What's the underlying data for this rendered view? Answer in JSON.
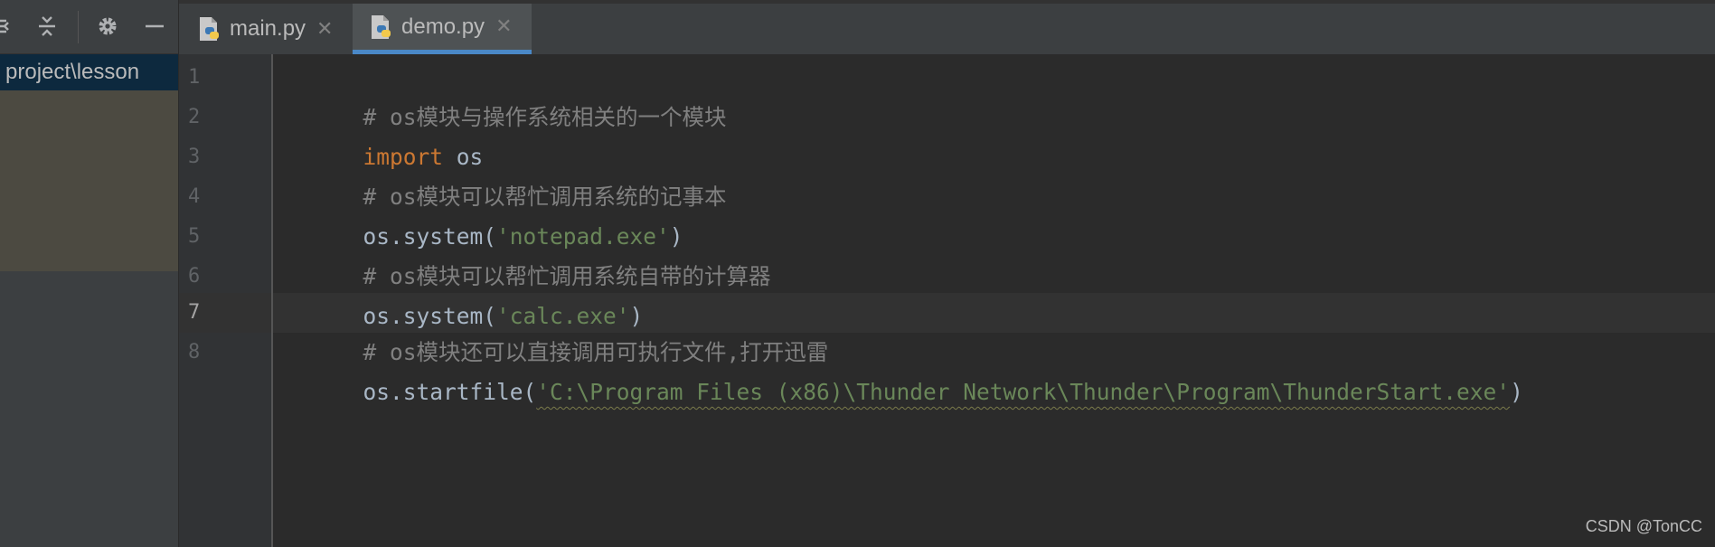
{
  "toolbar": {
    "icons": [
      "expand-all-icon",
      "collapse-all-icon",
      "gear-icon",
      "minimize-icon"
    ]
  },
  "project_panel": {
    "path": "project\\lesson"
  },
  "tabs": [
    {
      "label": "main.py",
      "close": "✕",
      "active": false
    },
    {
      "label": "demo.py",
      "close": "✕",
      "active": true
    }
  ],
  "editor": {
    "current_line": 7,
    "line_numbers": [
      "1",
      "2",
      "3",
      "4",
      "5",
      "6",
      "7",
      "8"
    ],
    "lines": [
      {
        "t1": "# os模块与操作系统相关的一个模块"
      },
      {
        "t1": "import",
        "t2": " os"
      },
      {
        "t1": "# os模块可以帮忙调用系统的记事本"
      },
      {
        "t1": "os.system(",
        "t2": "'notepad.exe'",
        "t3": ")"
      },
      {
        "t1": "# os模块可以帮忙调用系统自带的计算器"
      },
      {
        "t1": "os.system(",
        "t2": "'calc.exe'",
        "t3": ")"
      },
      {
        "t1": "# os模块还可以直接调用可执行文件,打开迅雷"
      },
      {
        "t1": "os.startfile(",
        "t2": "'C:\\Program Files (x86)\\Thunder Network\\Thunder\\Program\\ThunderStart.exe'",
        "t3": ")"
      }
    ]
  },
  "colors": {
    "keyword": "#cc7832",
    "string": "#6a8759",
    "comment": "#808080",
    "plain": "#a9b7c6",
    "active_tab_underline": "#4a88c7"
  },
  "watermark": "CSDN @TonCC"
}
